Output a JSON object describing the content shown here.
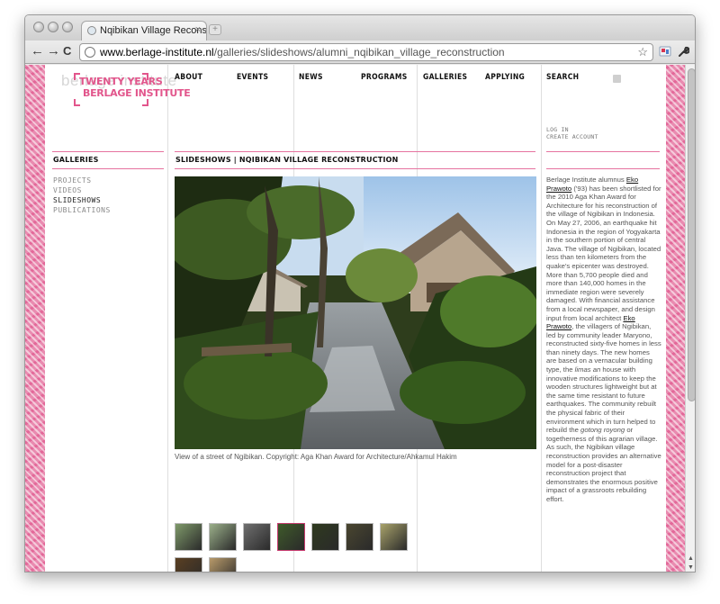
{
  "browser": {
    "tab_title": "Nqibikan Village Reconstruct",
    "tab_close": "×",
    "url_host": "www.berlage-institute.nl",
    "url_path": "/galleries/slideshows/alumni_nqibikan_village_reconstruction",
    "back": "←",
    "forward": "→",
    "reload": "C",
    "star": "☆",
    "wrench": "🔧"
  },
  "site": {
    "logo_ghost": "berlage institute",
    "logo_line1": "TWENTY YEARS",
    "logo_line2": "BERLAGE INSTITUTE",
    "nav": [
      "ABOUT",
      "EVENTS",
      "NEWS",
      "PROGRAMS",
      "GALLERIES",
      "APPLYING"
    ],
    "search": "SEARCH",
    "log_in": "LOG IN",
    "create_account": "CREATE ACCOUNT"
  },
  "sidebar": {
    "heading": "GALLERIES",
    "links": [
      "PROJECTS",
      "VIDEOS",
      "SLIDESHOWS",
      "PUBLICATIONS"
    ],
    "active_index": 2
  },
  "main": {
    "heading": "SLIDESHOWS | NQIBIKAN VILLAGE RECONSTRUCTION",
    "caption": "View of a street of Ngibikan. Copyright: Aga Khan Award for Architecture/Ahkamul Hakim",
    "thumbnails": [
      {
        "name": "thumb-1",
        "color": "#7f9a6a"
      },
      {
        "name": "thumb-2",
        "color": "#9bb08a"
      },
      {
        "name": "thumb-3",
        "color": "#6f6f6f"
      },
      {
        "name": "thumb-4",
        "color": "#3f5a2a",
        "selected": true
      },
      {
        "name": "thumb-5",
        "color": "#2f3a1f"
      },
      {
        "name": "thumb-6",
        "color": "#4a4630"
      },
      {
        "name": "thumb-7",
        "color": "#a8a26a"
      },
      {
        "name": "thumb-8",
        "color": "#5a3f22"
      },
      {
        "name": "thumb-9",
        "color": "#b89a6a"
      }
    ]
  },
  "article": {
    "p1": "Berlage Institute alumnus ",
    "link1": "Eko Prawoto",
    "p2": " ('93) has been shortlisted for the 2010 Aga Khan Award for Architecture for his reconstruction of the village of Ngibikan in Indonesia. On May 27, 2006, an earthquake hit Indonesia in the region of Yogyakarta in the southern portion of central Java. The village of Ngibikan, located less than ten kilometers from the quake's epicenter was destroyed. More than 5,700 people died and more than 140,000 homes in the immediate region were severely damaged. With financial assistance from a local newspaper, and design input from local architect ",
    "link2": "Eko Prawoto",
    "p3": ", the villagers of Ngibikan, led by community leader Maryono, reconstructed sixty-five homes in less than ninety days. The new homes are based on a vernacular building type, the ",
    "em1": "limas an",
    "p4": " house with innovative modifications to keep the wooden structures lightweight but at the same time resistant to future earthquakes. The community rebuilt the physical fabric of their environment which in turn helped to rebuild the ",
    "em2": "gotong royong",
    "p5": " or togetherness of this agrarian village. As such, the Ngibikan village reconstruction provides an alternative model for a post-disaster reconstruction project that demonstrates the enormous positive impact of a grassroots rebuilding effort."
  },
  "colors": {
    "accent_pink": "#e2568c",
    "rule_pink": "#e6739f"
  }
}
